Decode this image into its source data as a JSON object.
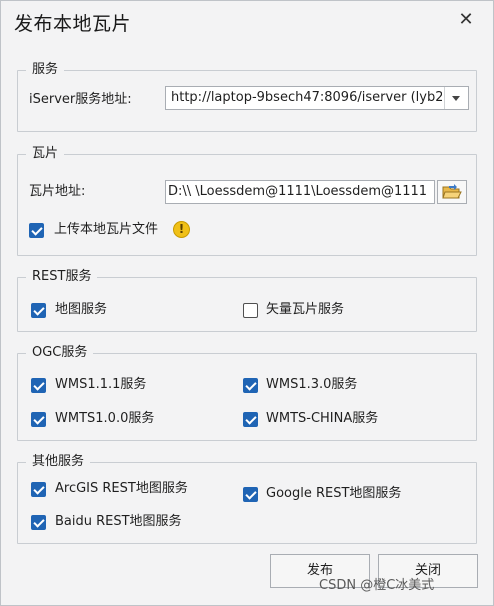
{
  "window": {
    "title": "发布本地瓦片"
  },
  "service": {
    "legend": "服务",
    "label": "iServer服务地址:",
    "value": "http://laptop-9bsech47:8096/iserver (lyb202"
  },
  "tile": {
    "legend": "瓦片",
    "label": "瓦片地址:",
    "path": "D:\\\\   \\Loessdem@1111\\Loessdem@1111",
    "upload_label": "上传本地瓦片文件",
    "upload_checked": true
  },
  "rest": {
    "legend": "REST服务",
    "items": [
      {
        "label": "地图服务",
        "checked": true
      },
      {
        "label": "矢量瓦片服务",
        "checked": false
      }
    ]
  },
  "ogc": {
    "legend": "OGC服务",
    "items": [
      {
        "label": "WMS1.1.1服务",
        "checked": true
      },
      {
        "label": "WMS1.3.0服务",
        "checked": true
      },
      {
        "label": "WMTS1.0.0服务",
        "checked": true
      },
      {
        "label": "WMTS-CHINA服务",
        "checked": true
      }
    ]
  },
  "other": {
    "legend": "其他服务",
    "items": [
      {
        "label": "ArcGIS REST地图服务",
        "checked": true
      },
      {
        "label": "Google REST地图服务",
        "checked": true
      },
      {
        "label": "Baidu REST地图服务",
        "checked": true
      }
    ]
  },
  "buttons": {
    "publish": "发布",
    "close": "关闭"
  },
  "watermark": "CSDN @橙C冰美式",
  "icons": {
    "close": "close-icon",
    "dropdown": "chevron-down-icon",
    "folder": "folder-open-icon",
    "warning": "warning-icon"
  },
  "colors": {
    "accent": "#1f64b4",
    "warning": "#f0c017"
  }
}
